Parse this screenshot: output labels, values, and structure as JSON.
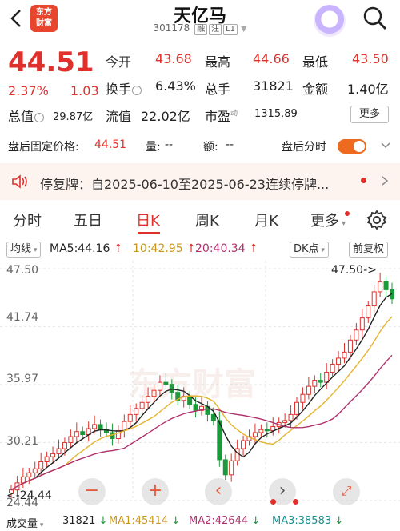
{
  "header": {
    "logo_line1": "东方",
    "logo_line2": "财富",
    "title": "天亿马",
    "code": "301178",
    "tags": [
      "融",
      "注",
      "L1"
    ]
  },
  "quote": {
    "price": "44.51",
    "change_pct": "2.37%",
    "change": "1.03",
    "open_label": "今开",
    "open": "43.68",
    "high_label": "最高",
    "high": "44.66",
    "low_label": "最低",
    "low": "43.50",
    "turnover_label": "换手",
    "turnover": "6.43%",
    "volume_label": "总手",
    "volume": "31821",
    "amount_label": "金额",
    "amount": "1.40亿",
    "mktcap_label": "总值",
    "mktcap": "29.87亿",
    "float_label": "流值",
    "float": "22.02亿",
    "pe_label": "市盈",
    "pe_super": "动",
    "pe": "1315.89",
    "more_label": "更多"
  },
  "after_hours": {
    "price_label": "盘后固定价格:",
    "price": "44.51",
    "qty_label": "量:",
    "qty": "--",
    "amount_label": "额:",
    "amount": "--",
    "timeshare_label": "盘后分时"
  },
  "notice": {
    "text": "停复牌：自2025-06-10至2025-06-23连续停牌..."
  },
  "tabs": [
    "分时",
    "五日",
    "日K",
    "周K",
    "月K",
    "更多"
  ],
  "active_tab": "日K",
  "ma": {
    "mode_label": "均线",
    "ma5": "MA5:44.16",
    "ma10": "10:42.95",
    "ma20": "20:40.34",
    "dk_label": "DK点",
    "adjust_label": "前复权"
  },
  "chart_data": {
    "type": "candlestick",
    "y_ticks": [
      "47.50",
      "41.74",
      "35.97",
      "30.21",
      "24.44"
    ],
    "ylim": [
      24.44,
      47.5
    ],
    "max_marker": "47.50->",
    "min_marker": "<-24.44",
    "watermark": "东方财富",
    "colors": {
      "up": "#e0302b",
      "down": "#1a9a3a",
      "ma5": "#222222",
      "ma10": "#e6b32e",
      "ma20": "#b0306c"
    }
  },
  "volume": {
    "label": "成交量",
    "value": "31821",
    "ma1": "MA1:45414",
    "ma2": "MA2:42644",
    "ma3": "MA3:38583"
  }
}
